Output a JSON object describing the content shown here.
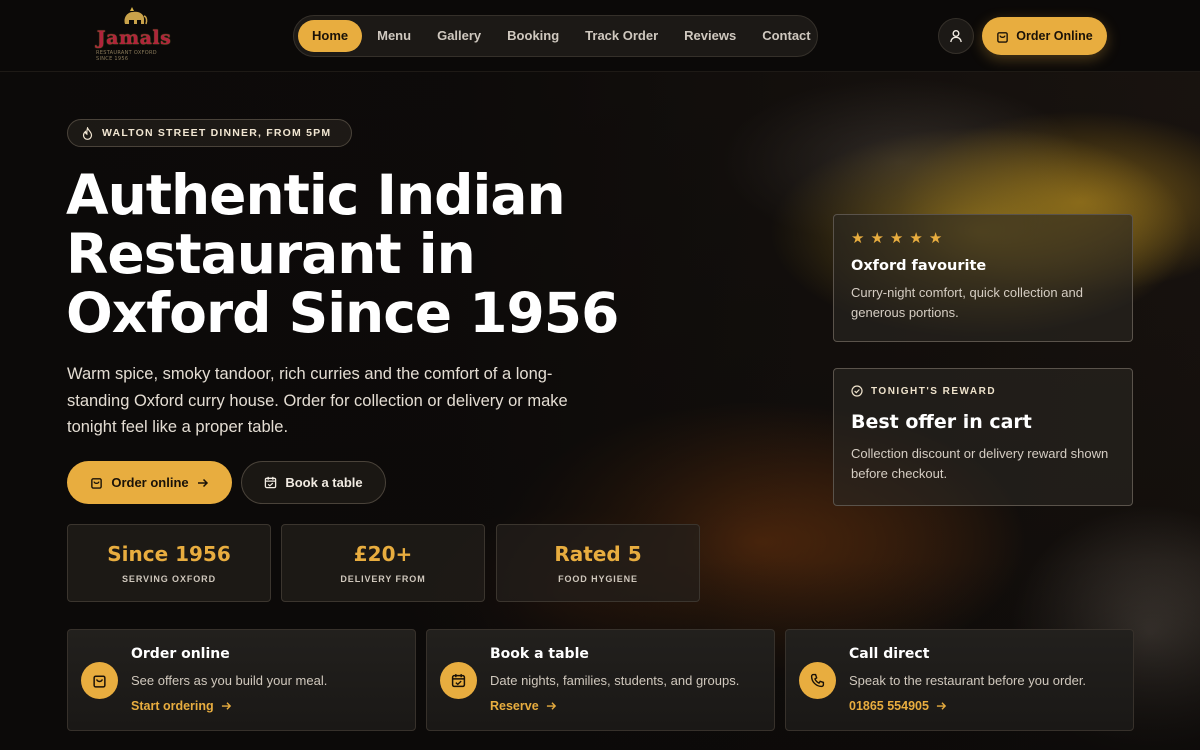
{
  "brand": {
    "logo_text": "Jamals",
    "logo_tagline": "RESTAURANT OXFORD SINCE 1956"
  },
  "nav": {
    "items": [
      {
        "label": "Home",
        "active": true
      },
      {
        "label": "Menu",
        "active": false
      },
      {
        "label": "Gallery",
        "active": false
      },
      {
        "label": "Booking",
        "active": false
      },
      {
        "label": "Track Order",
        "active": false
      },
      {
        "label": "Reviews",
        "active": false
      },
      {
        "label": "Contact",
        "active": false
      }
    ],
    "account_icon": "user-icon",
    "order_button_label": "Order Online"
  },
  "hero": {
    "eyebrow": "WALTON STREET DINNER, FROM 5PM",
    "headline_lines": [
      "Authentic Indian",
      "Restaurant in",
      "Oxford Since 1956"
    ],
    "lede": "Warm spice, smoky tandoor, rich curries and the comfort of a long-standing Oxford curry house. Order for collection or delivery or make tonight feel like a proper table.",
    "primary_cta": "Order online",
    "secondary_cta": "Book a table"
  },
  "stats": [
    {
      "value": "Since 1956",
      "label": "SERVING OXFORD"
    },
    {
      "value": "£20+",
      "label": "DELIVERY FROM"
    },
    {
      "value": "Rated 5",
      "label": "FOOD HYGIENE"
    }
  ],
  "cards": {
    "favourite": {
      "rating": 5,
      "title": "Oxford favourite",
      "text": "Curry-night comfort, quick collection and generous portions."
    },
    "reward": {
      "eyebrow": "TONIGHT'S REWARD",
      "title": "Best offer in cart",
      "text": "Collection discount or delivery reward shown before checkout."
    }
  },
  "features": [
    {
      "icon": "shopping-bag-icon",
      "title": "Order online",
      "text": "See offers as you build your meal.",
      "link": "Start ordering"
    },
    {
      "icon": "calendar-icon",
      "title": "Book a table",
      "text": "Date nights, families, students, and groups.",
      "link": "Reserve"
    },
    {
      "icon": "phone-icon",
      "title": "Call direct",
      "text": "Speak to the restaurant before you order.",
      "link": "01865 554905"
    }
  ],
  "colors": {
    "accent": "#e8ad3f",
    "background": "#0c0a09",
    "brand_red": "#b0233b"
  }
}
